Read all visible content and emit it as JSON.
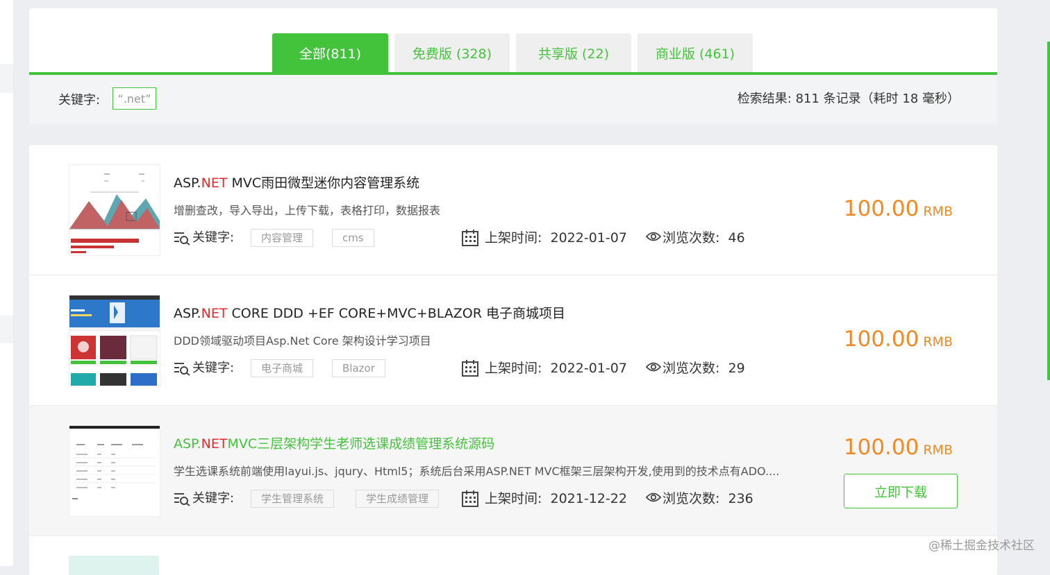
{
  "tabs": [
    {
      "label": "全部(811)",
      "active": true
    },
    {
      "label": "免费版 (328)",
      "active": false
    },
    {
      "label": "共享版 (22)",
      "active": false
    },
    {
      "label": "商业版 (461)",
      "active": false
    }
  ],
  "filter": {
    "keyword_label": "关键字:",
    "keyword_value": "“.net”",
    "summary": "检索结果: 811 条记录（耗时 18 毫秒）"
  },
  "meta_labels": {
    "keyword": "关键字:",
    "listed": "上架时间:",
    "views": "浏览次数:"
  },
  "items": [
    {
      "title_highlight_prefix": "ASP.",
      "title_highlight": "NET",
      "title_rest": " MVC雨田微型迷你内容管理系统",
      "description": "增删查改，导入导出，上传下载，表格打印，数据报表",
      "tags": [
        "内容管理",
        "cms"
      ],
      "date": "2022-01-07",
      "views": "46",
      "price": "100.00",
      "currency": "RMB"
    },
    {
      "title_highlight_prefix": "ASP.",
      "title_highlight": "NET",
      "title_rest": " CORE DDD +EF CORE+MVC+BLAZOR 电子商城项目",
      "description": "DDD领域驱动项目Asp.Net Core 架构设计学习项目",
      "tags": [
        "电子商城",
        "Blazor"
      ],
      "date": "2022-01-07",
      "views": "29",
      "price": "100.00",
      "currency": "RMB"
    },
    {
      "title_highlight_prefix": "ASP.",
      "title_highlight": "NET",
      "title_rest": "MVC三层架构学生老师选课成绩管理系统源码",
      "description": "学生选课系统前端使用layui.js、jqury、Html5；系统后台采用ASP.NET MVC框架三层架构开发,使用到的技术点有ADO....",
      "tags": [
        "学生管理系统",
        "学生成绩管理"
      ],
      "date": "2021-12-22",
      "views": "236",
      "price": "100.00",
      "currency": "RMB",
      "download_label": "立即下载"
    }
  ],
  "watermark": "@稀土掘金技术社区",
  "colors": {
    "accent": "#43c33b",
    "price": "#f08a24",
    "highlight": "#e52a2a"
  }
}
